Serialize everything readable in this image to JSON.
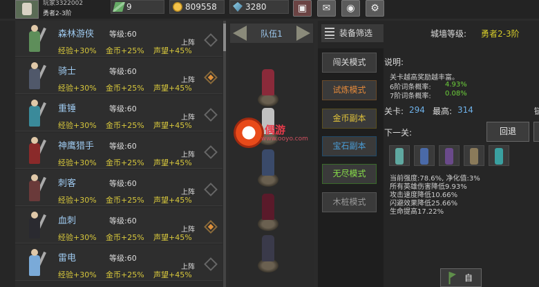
{
  "topbar": {
    "player_name": "玩家3322002",
    "player_rank": "勇者2-3阶",
    "energy": "9",
    "gold": "809558",
    "gems": "3280",
    "icons": [
      "energy-icon",
      "gold-coin-icon",
      "gem-icon",
      "shop-icon",
      "mail-icon",
      "gamepad-icon",
      "gear-icon"
    ]
  },
  "heroes": [
    {
      "name": "森林游侠",
      "level": "等级:60",
      "exp": "经验+30%",
      "gold": "金币+25%",
      "fame": "声望+45%",
      "deploy": "上阵",
      "selected": false,
      "color": "#5e8e5a"
    },
    {
      "name": "骑士",
      "level": "等级:60",
      "exp": "经验+30%",
      "gold": "金币+25%",
      "fame": "声望+45%",
      "deploy": "上阵",
      "selected": true,
      "color": "#50586a"
    },
    {
      "name": "重锤",
      "level": "等级:60",
      "exp": "经验+30%",
      "gold": "金币+25%",
      "fame": "声望+45%",
      "deploy": "上阵",
      "selected": false,
      "color": "#3a8a9a"
    },
    {
      "name": "神鹰猎手",
      "level": "等级:60",
      "exp": "经验+30%",
      "gold": "金币+25%",
      "fame": "声望+45%",
      "deploy": "上阵",
      "selected": false,
      "color": "#8a2a2a"
    },
    {
      "name": "刺客",
      "level": "等级:60",
      "exp": "经验+30%",
      "gold": "金币+25%",
      "fame": "声望+45%",
      "deploy": "上阵",
      "selected": false,
      "color": "#6a3a3a"
    },
    {
      "name": "血刺",
      "level": "等级:60",
      "exp": "经验+30%",
      "gold": "金币+25%",
      "fame": "声望+45%",
      "deploy": "上阵",
      "selected": true,
      "color": "#2a2a30"
    },
    {
      "name": "雷电",
      "level": "等级:60",
      "exp": "经验+30%",
      "gold": "金币+25%",
      "fame": "声望+45%",
      "deploy": "上阵",
      "selected": false,
      "color": "#7aaad8"
    }
  ],
  "team": {
    "label": "队伍1",
    "members": [
      "#8a2a3a",
      "#c0c0c0",
      "#3a4a6a",
      "#5a1a2a",
      "#3a3a4a"
    ]
  },
  "watermark": {
    "text": "偶游",
    "sub": "www.ooyo.com"
  },
  "filter": {
    "label": "装备筛选"
  },
  "wall_level": {
    "label": "城墙等级:",
    "value": "勇者2-3阶"
  },
  "modes": [
    "闯关模式",
    "试炼模式",
    "金币副本",
    "宝石副本",
    "无尽模式",
    "木桩模式"
  ],
  "info": {
    "desc_title": "说明:",
    "desc_text": "关卡越高奖励越丰富。",
    "rate6_label": "6阶词条概率:",
    "rate6_value": "4.93%",
    "rate7_label": "7阶词条概率:",
    "rate7_value": "0.08%",
    "stage_label": "关卡:",
    "stage_value": "294",
    "best_label": "最高:",
    "best_value": "314",
    "stage_edge": "链",
    "next_label": "下一关:",
    "back_button": "回退",
    "enemies": [
      "#5fa8a0",
      "#4a6aa8",
      "#6a4a8a",
      "#8a7a5a",
      "#3aa0a0"
    ],
    "stats": [
      "当前强度:78.6%, 净化值:3%",
      "所有英雄伤害降低9.93%",
      "攻击速度降低10.66%",
      "闪避效果降低25.66%",
      "生命提高17.22%"
    ],
    "bottom_button": "自"
  }
}
